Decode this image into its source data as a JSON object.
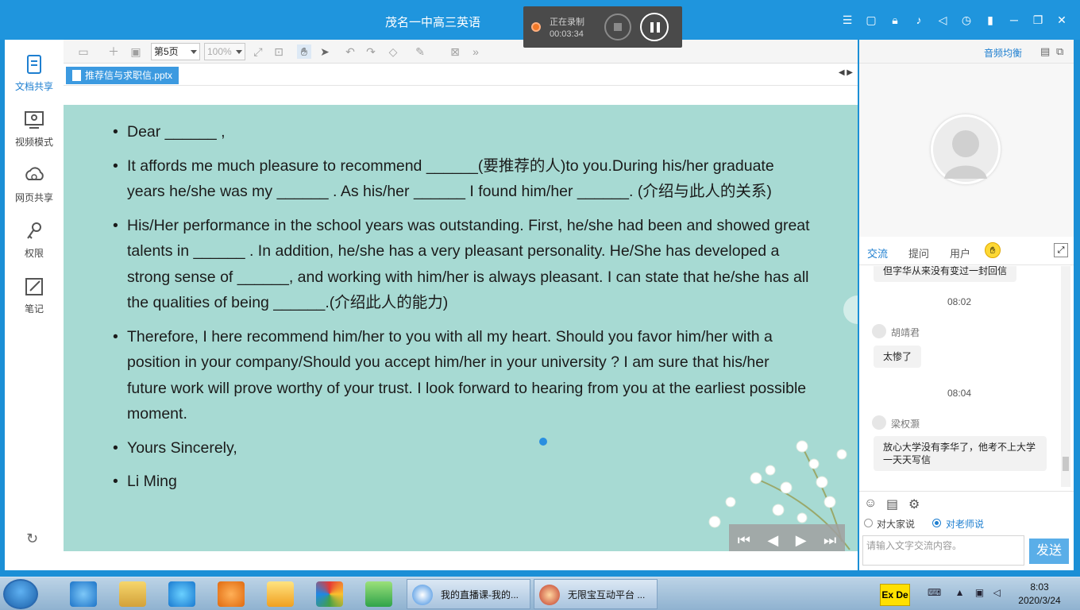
{
  "window": {
    "title": "茂名一中高三英语",
    "recording": {
      "label": "正在录制",
      "time": "00:03:34"
    }
  },
  "leftnav": {
    "items": [
      {
        "label": "文档共享",
        "icon": "document-share-icon"
      },
      {
        "label": "视频模式",
        "icon": "video-mode-icon"
      },
      {
        "label": "网页共享",
        "icon": "web-share-icon"
      },
      {
        "label": "权限",
        "icon": "permission-key-icon"
      },
      {
        "label": "笔记",
        "icon": "note-edit-icon"
      }
    ]
  },
  "doc_toolbar": {
    "page_value": "第5页",
    "zoom_value": "100%",
    "tab_label": "推荐信与求职信.pptx"
  },
  "slide": {
    "bullets": [
      "Dear ______ ,",
      "It affords me much pleasure to recommend ______(要推荐的人)to you.During his/her graduate years he/she was my ______ . As his/her ______ I found him/her ______. (介绍与此人的关系)",
      "His/Her performance in the school years was outstanding. First, he/she had been and showed great talents in ______ . In addition, he/she has a very pleasant personality. He/She has developed a strong sense of ______, and working with him/her is always pleasant. I can state that he/she has all the qualities of being ______.(介绍此人的能力)",
      "Therefore, I here recommend him/her to you with all my heart. Should you favor him/her with a position in your company/Should you accept him/her in your university ? I am sure that his/her future work will prove worthy of your trust. I look forward to hearing from you at the earliest possible moment.",
      "Yours Sincerely,",
      "Li Ming"
    ]
  },
  "right_panel": {
    "audio_balance": "音频均衡",
    "tabs": [
      "交流",
      "提问",
      "用户"
    ],
    "chat": {
      "partial_message": "但字华从来没有变过一封回信",
      "messages": [
        {
          "time": "08:02",
          "sender": "胡靖君",
          "text": "太惨了"
        },
        {
          "time": "08:04",
          "sender": "梁权灏",
          "text": "放心大学没有李华了，他考不上大学一天天写信"
        }
      ]
    },
    "radio_all": "对大家说",
    "radio_teacher": "对老师说",
    "input_placeholder": "请输入文字交流内容。",
    "send_label": "发送"
  },
  "taskbar": {
    "tasks": [
      "我的直播课-我的...",
      "无限宝互动平台 ..."
    ],
    "tray_label": "Ex De",
    "time": "8:03",
    "date": "2020/3/24"
  },
  "colors": {
    "accent": "#1f95dd",
    "slide_bg": "#a7dad3",
    "active_nav": "#1e7fd0"
  }
}
